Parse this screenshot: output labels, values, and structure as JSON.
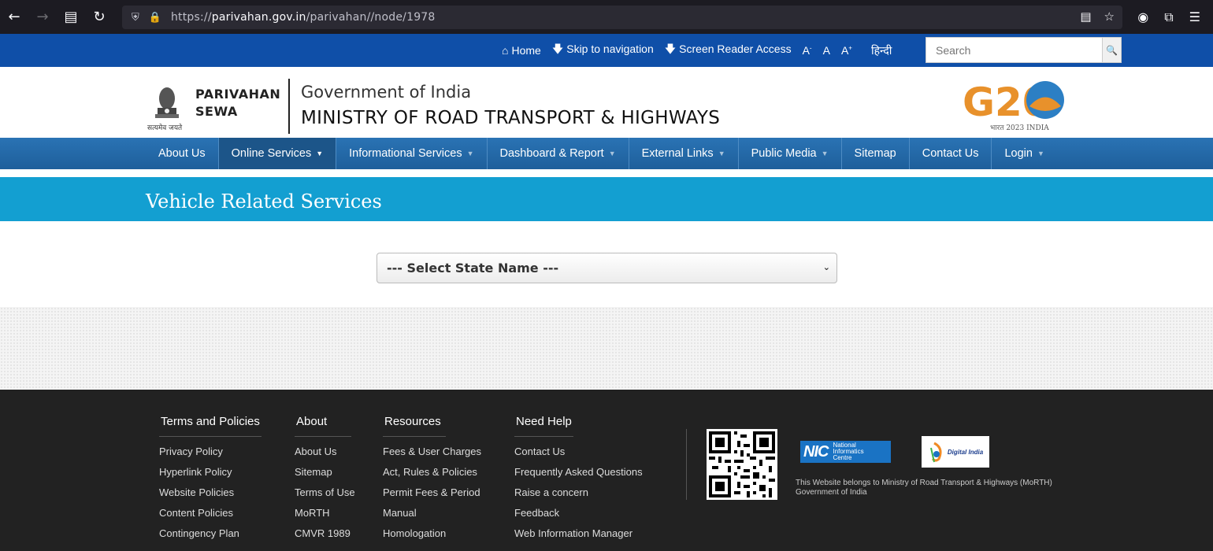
{
  "browser": {
    "url_prefix": "https://",
    "url_domain": "parivahan.gov.in",
    "url_path": "/parivahan//node/1978"
  },
  "utility": {
    "home": "Home",
    "skip": "Skip to navigation",
    "screen_reader": "Screen Reader Access",
    "font_small": "A",
    "font_small_sup": "-",
    "font_normal": "A",
    "font_large": "A",
    "font_large_sup": "+",
    "hindi": "हिन्दी",
    "search_placeholder": "Search"
  },
  "header": {
    "emblem_motto": "सत्यमेव जयते",
    "brand_line1": "PARIVAHAN",
    "brand_line2": "SEWA",
    "gov": "Government of India",
    "ministry": "MINISTRY OF ROAD TRANSPORT & HIGHWAYS",
    "g20_text": "G20",
    "g20_sub": "भारत 2023 INDIA"
  },
  "nav": {
    "items": [
      {
        "label": "About Us"
      },
      {
        "label": "Online Services"
      },
      {
        "label": "Informational Services"
      },
      {
        "label": "Dashboard & Report"
      },
      {
        "label": "External Links"
      },
      {
        "label": "Public Media"
      },
      {
        "label": "Sitemap"
      },
      {
        "label": "Contact Us"
      },
      {
        "label": "Login"
      }
    ]
  },
  "banner": {
    "title": "Vehicle Related Services"
  },
  "state_select": {
    "value": "--- Select State Name ---"
  },
  "footer": {
    "col1": {
      "head": "Terms and Policies",
      "links": [
        "Privacy Policy",
        "Hyperlink Policy",
        "Website Policies",
        "Content Policies",
        "Contingency Plan"
      ]
    },
    "col2": {
      "head": "About",
      "links": [
        "About Us",
        "Sitemap",
        "Terms of Use",
        "MoRTH",
        "CMVR 1989"
      ]
    },
    "col3": {
      "head": "Resources",
      "links": [
        "Fees & User Charges",
        "Act, Rules & Policies",
        "Permit Fees & Period",
        "Manual",
        "Homologation"
      ]
    },
    "col4": {
      "head": "Need Help",
      "links": [
        "Contact Us",
        "Frequently Asked Questions",
        "Raise a concern",
        "Feedback",
        "Web Information Manager"
      ]
    },
    "nic_big": "NIC",
    "nic_small1": "National",
    "nic_small2": "Informatics",
    "nic_small3": "Centre",
    "di_text": "Digital India",
    "note1": "This Website belongs to Ministry of Road Transport & Highways (MoRTH)",
    "note2": "Government of India"
  }
}
